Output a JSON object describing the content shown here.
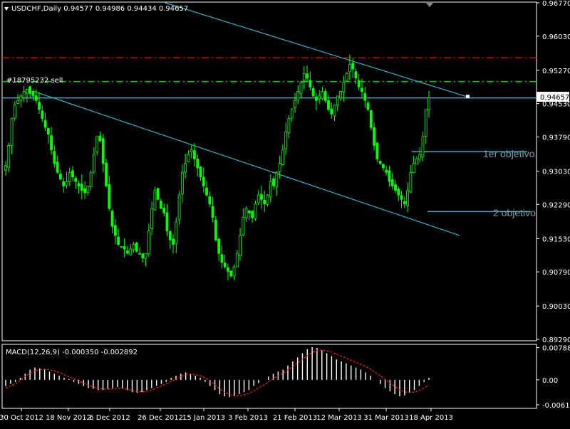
{
  "header": {
    "symbol_line": "USDCHF,Daily  0.94577 0.94986 0.94434 0.94657"
  },
  "order_label": "#18795232 sell",
  "current_price": "0.94657",
  "annotations": {
    "target1": "1er objetivo",
    "target2": "2 objetivo"
  },
  "macd": {
    "label": "MACD(12,26,9) -0.000350 -0.002892",
    "ticks": [
      "0.007885",
      "0.00",
      "-0.006104"
    ]
  },
  "colors": {
    "background": "#000000",
    "bull": "#00ff00",
    "channel": "#2ab7c9",
    "red_level": "#cc0000",
    "green_level": "#00cc00",
    "macd_signal": "#ff2020",
    "frame": "#ffffff"
  },
  "chart_data": {
    "type": "candlestick",
    "symbol": "USDCHF",
    "timeframe": "Daily",
    "ohlc_current": {
      "open": 0.94577,
      "high": 0.94986,
      "low": 0.94434,
      "close": 0.94657
    },
    "y_ticks": [
      "0.96770",
      "0.96030",
      "0.95270",
      "0.94530",
      "0.93790",
      "0.93030",
      "0.92290",
      "0.91530",
      "0.90790",
      "0.90030",
      "0.89290"
    ],
    "ylim": [
      0.8929,
      0.9677
    ],
    "x_ticks": [
      "30 Oct 2012",
      "18 Nov 2012",
      "6 Dec 2012",
      "26 Dec 2012",
      "15 Jan 2013",
      "3 Feb 2013",
      "21 Feb 2013",
      "12 Mar 2013",
      "31 Mar 2013",
      "18 Apr 2013"
    ],
    "horizontal_levels": [
      {
        "value": 0.9555,
        "style": "dash-dot",
        "color": "red"
      },
      {
        "value": 0.9502,
        "style": "dash-dot",
        "color": "green"
      },
      {
        "value": 0.94657,
        "style": "solid",
        "color": "channel"
      },
      {
        "value": 0.9346,
        "style": "solid",
        "color": "channel",
        "label": "1er objetivo"
      },
      {
        "value": 0.9213,
        "style": "solid",
        "color": "channel",
        "label": "2 objetivo"
      }
    ],
    "close_path": [
      0.9315,
      0.936,
      0.942,
      0.945,
      0.946,
      0.947,
      0.948,
      0.9485,
      0.9475,
      0.947,
      0.946,
      0.944,
      0.942,
      0.94,
      0.9385,
      0.935,
      0.932,
      0.93,
      0.9285,
      0.927,
      0.928,
      0.93,
      0.929,
      0.928,
      0.927,
      0.926,
      0.9255,
      0.927,
      0.93,
      0.934,
      0.938,
      0.937,
      0.932,
      0.927,
      0.922,
      0.918,
      0.916,
      0.914,
      0.9135,
      0.913,
      0.912,
      0.913,
      0.914,
      0.9125,
      0.912,
      0.911,
      0.912,
      0.917,
      0.922,
      0.926,
      0.924,
      0.922,
      0.921,
      0.917,
      0.915,
      0.914,
      0.919,
      0.925,
      0.93,
      0.932,
      0.934,
      0.935,
      0.933,
      0.931,
      0.929,
      0.927,
      0.925,
      0.923,
      0.92,
      0.915,
      0.912,
      0.91,
      0.909,
      0.908,
      0.907,
      0.909,
      0.912,
      0.916,
      0.92,
      0.922,
      0.921,
      0.92,
      0.923,
      0.925,
      0.924,
      0.923,
      0.925,
      0.928,
      0.927,
      0.93,
      0.932,
      0.935,
      0.939,
      0.942,
      0.944,
      0.946,
      0.948,
      0.95,
      0.952,
      0.951,
      0.949,
      0.947,
      0.946,
      0.947,
      0.948,
      0.946,
      0.944,
      0.943,
      0.945,
      0.947,
      0.948,
      0.95,
      0.952,
      0.954,
      0.953,
      0.951,
      0.949,
      0.948,
      0.946,
      0.944,
      0.94,
      0.936,
      0.933,
      0.932,
      0.931,
      0.93,
      0.928,
      0.927,
      0.926,
      0.925,
      0.924,
      0.923,
      0.926,
      0.93,
      0.932,
      0.933,
      0.934,
      0.938,
      0.944,
      0.9466
    ],
    "macd_hist": [
      -0.0015,
      -0.001,
      -0.0005,
      0.0005,
      0.0015,
      0.0025,
      0.003,
      0.0028,
      0.0025,
      0.002,
      0.0015,
      0.001,
      0.0005,
      0.0002,
      -0.0005,
      -0.001,
      -0.0015,
      -0.002,
      -0.0022,
      -0.0025,
      -0.0025,
      -0.0022,
      -0.002,
      -0.0018,
      -0.002,
      -0.0025,
      -0.003,
      -0.0032,
      -0.003,
      -0.0025,
      -0.002,
      -0.0015,
      -0.001,
      -0.0005,
      0.0005,
      0.001,
      0.0015,
      0.0018,
      0.0015,
      0.001,
      0.0005,
      -0.0005,
      -0.0015,
      -0.0025,
      -0.0035,
      -0.004,
      -0.0042,
      -0.004,
      -0.0035,
      -0.003,
      -0.0025,
      -0.0015,
      -0.0008,
      0.0,
      0.0008,
      0.0015,
      0.002,
      0.0025,
      0.0035,
      0.0045,
      0.0055,
      0.0065,
      0.0075,
      0.008,
      0.0078,
      0.0072,
      0.0065,
      0.0058,
      0.005,
      0.0045,
      0.004,
      0.0035,
      0.003,
      0.0025,
      0.0018,
      0.001,
      0.0,
      -0.001,
      -0.002,
      -0.0028,
      -0.0035,
      -0.004,
      -0.0038,
      -0.0032,
      -0.0025,
      -0.0015,
      -0.0005,
      0.0005
    ],
    "macd_signal": [
      -0.002,
      -0.0015,
      -0.001,
      -0.0002,
      0.0008,
      0.0016,
      0.0022,
      0.0025,
      0.0026,
      0.0025,
      0.0022,
      0.0018,
      0.0013,
      0.0008,
      0.0003,
      -0.0003,
      -0.0008,
      -0.0013,
      -0.0017,
      -0.002,
      -0.0022,
      -0.0023,
      -0.0022,
      -0.0021,
      -0.0021,
      -0.0023,
      -0.0026,
      -0.0028,
      -0.0029,
      -0.0028,
      -0.0025,
      -0.002,
      -0.0015,
      -0.001,
      -0.0004,
      0.0002,
      0.0008,
      0.0012,
      0.0014,
      0.0013,
      0.001,
      0.0005,
      -0.0003,
      -0.0012,
      -0.0022,
      -0.003,
      -0.0036,
      -0.0039,
      -0.0039,
      -0.0037,
      -0.0033,
      -0.0027,
      -0.002,
      -0.0013,
      -0.0005,
      0.0003,
      0.001,
      0.0016,
      0.0024,
      0.0032,
      0.0041,
      0.005,
      0.0059,
      0.0067,
      0.0072,
      0.0073,
      0.0071,
      0.0068,
      0.0063,
      0.0058,
      0.0053,
      0.0048,
      0.0043,
      0.0038,
      0.0033,
      0.0026,
      0.0018,
      0.001,
      0.0001,
      -0.0008,
      -0.0016,
      -0.0024,
      -0.0029,
      -0.0031,
      -0.003,
      -0.0026,
      -0.002,
      -0.0013
    ]
  }
}
